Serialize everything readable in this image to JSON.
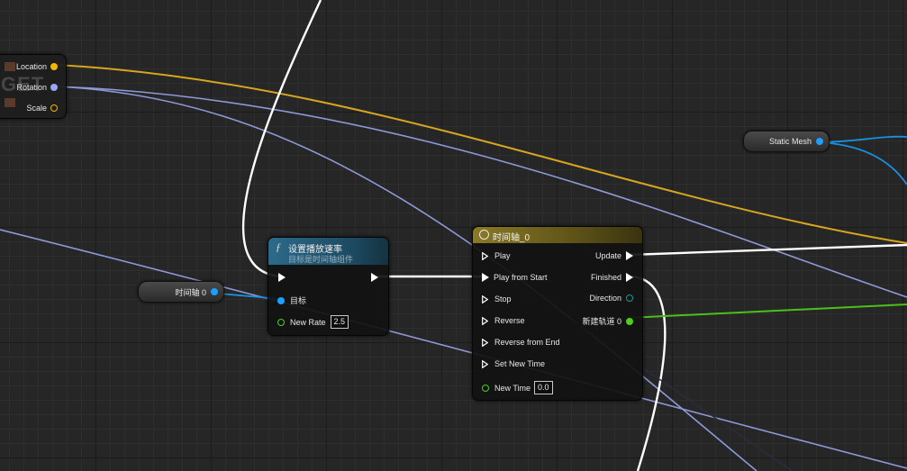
{
  "break_node": {
    "watermark": "GET",
    "pins": [
      {
        "label": "Location",
        "color": "#f0b800"
      },
      {
        "label": "Rotation",
        "color": "#9aa8f0"
      },
      {
        "label": "Scale",
        "color": "#f0b800"
      }
    ]
  },
  "static_mesh_node": {
    "label": "Static Mesh",
    "pin_color": "#1aa0ff"
  },
  "timeline_var_node": {
    "label": "时间轴 0",
    "pin_color": "#1aa0ff"
  },
  "set_play_rate_node": {
    "title": "设置播放速率",
    "subtitle": "目标是时间轴组件",
    "title_icon": "function-icon",
    "target_label": "目标",
    "new_rate_label": "New Rate",
    "new_rate_value": "2.5"
  },
  "timeline_node": {
    "title": "时间轴_0",
    "title_icon": "clock-icon",
    "inputs": [
      "Play",
      "Play from Start",
      "Stop",
      "Reverse",
      "Reverse from End",
      "Set New Time"
    ],
    "new_time_label": "New Time",
    "new_time_value": "0.0",
    "outputs": [
      "Update",
      "Finished",
      "Direction",
      "新建轨道 0"
    ]
  },
  "colors": {
    "exec": "#ffffff",
    "vector": "#f0b800",
    "rotator": "#9aa8f0",
    "object": "#1aa0ff",
    "float": "#4ad019",
    "timeline_header": "#7a6a1a",
    "function_header": "#2d6a8a"
  }
}
